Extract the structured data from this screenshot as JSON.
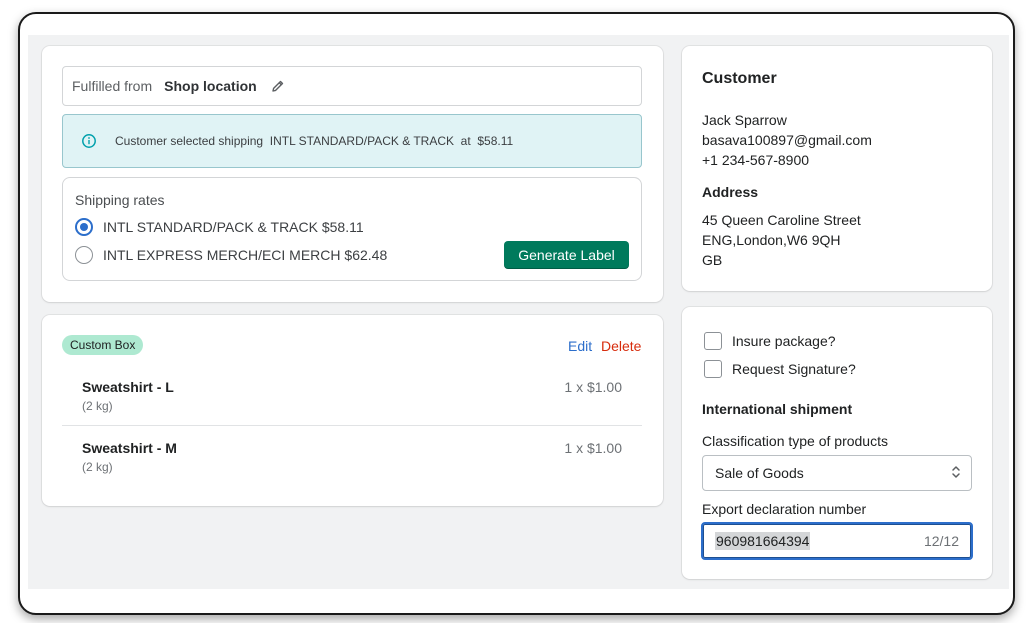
{
  "fulfillment": {
    "fulfilled_from_label": "Fulfilled from",
    "location": "Shop location",
    "edit_icon": "pencil-icon"
  },
  "banner": {
    "icon": "info-icon",
    "text": "Customer selected shipping  INTL STANDARD/PACK & TRACK  at  $58.11"
  },
  "shipping_rates": {
    "title": "Shipping rates",
    "options": [
      {
        "label": "INTL STANDARD/PACK & TRACK $58.11",
        "selected": true
      },
      {
        "label": "INTL EXPRESS MERCH/ECI MERCH $62.48",
        "selected": false
      }
    ],
    "generate_label": "Generate Label",
    "button_color": "#007a5c"
  },
  "package": {
    "badge": "Custom Box",
    "edit": "Edit",
    "delete": "Delete",
    "items": [
      {
        "name": "Sweatshirt - L",
        "weight": "(2 kg)",
        "price": "1 x $1.00"
      },
      {
        "name": "Sweatshirt - M",
        "weight": "(2 kg)",
        "price": "1 x $1.00"
      }
    ]
  },
  "customer": {
    "title": "Customer",
    "name": "Jack Sparrow",
    "email": "basava100897@gmail.com",
    "phone": "+1 234-567-8900",
    "address_title": "Address",
    "address_lines": [
      "45 Queen Caroline Street",
      "ENG,London,W6 9QH",
      "GB"
    ]
  },
  "options": {
    "insure_label": "Insure package?",
    "signature_label": "Request Signature?",
    "international_title": "International shipment",
    "classification_label": "Classification type of products",
    "classification_value": "Sale of Goods",
    "export_label": "Export declaration number",
    "export_value": "960981664394",
    "export_count": "12/12"
  }
}
